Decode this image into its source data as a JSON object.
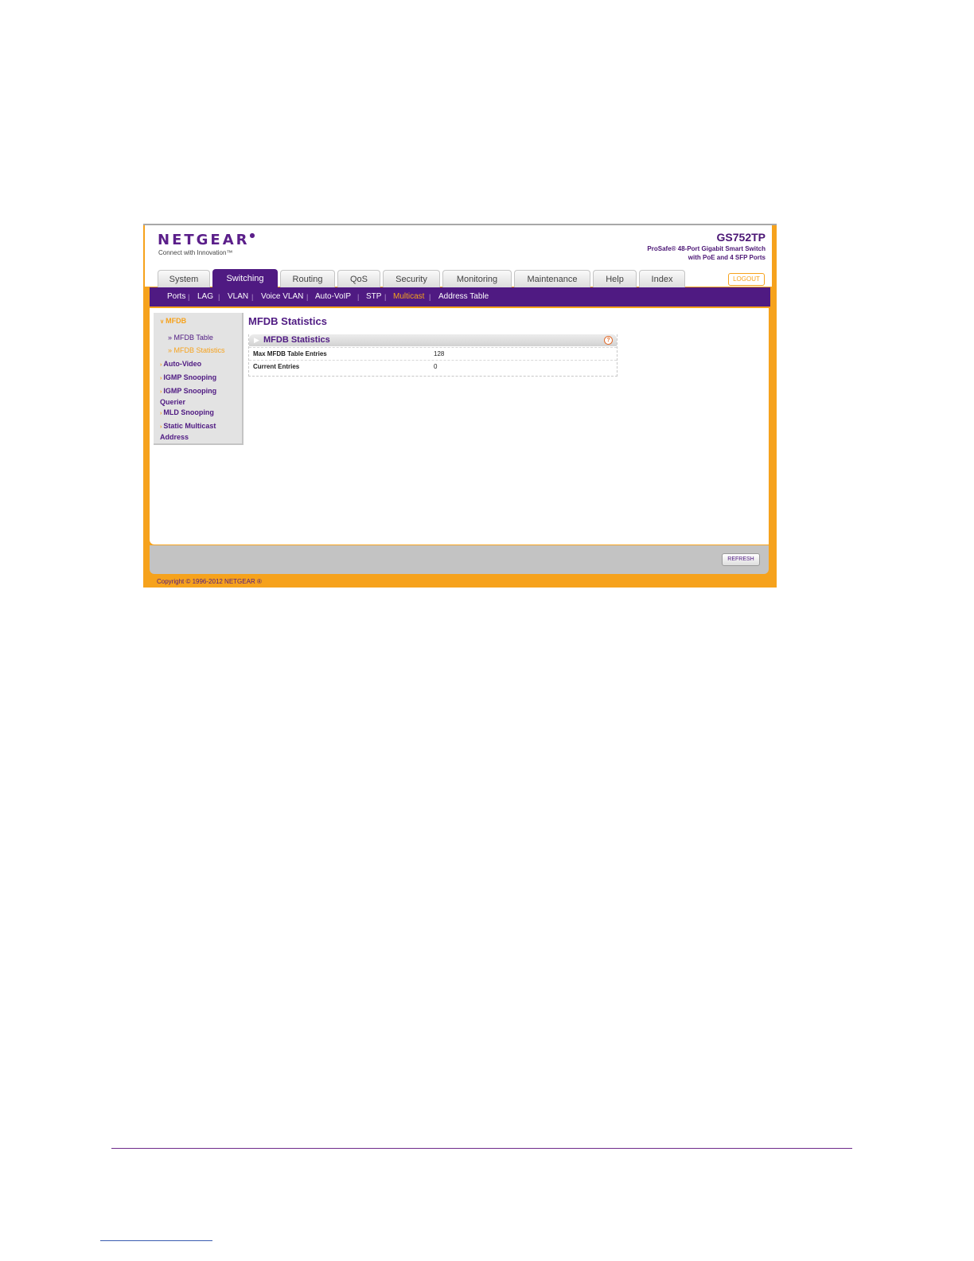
{
  "brand": {
    "logo": "NETGEAR",
    "tagline": "Connect with Innovation™",
    "model": "GS752TP",
    "product_line1": "ProSafe® 48-Port Gigabit Smart Switch",
    "product_line2": "with PoE and 4 SFP Ports"
  },
  "tabs": [
    "System",
    "Switching",
    "Routing",
    "QoS",
    "Security",
    "Monitoring",
    "Maintenance",
    "Help",
    "Index"
  ],
  "active_tab": "Switching",
  "logout_label": "LOGOUT",
  "subnav": [
    "Ports",
    "LAG",
    "VLAN",
    "Voice VLAN",
    "Auto-VoIP",
    "STP",
    "Multicast",
    "Address Table"
  ],
  "active_subnav": "Multicast",
  "sidebar": {
    "items": [
      {
        "label": "MFDB",
        "open": true,
        "children": [
          "MFDB Table",
          "MFDB Statistics"
        ]
      },
      {
        "label": "Auto-Video"
      },
      {
        "label": "IGMP Snooping"
      },
      {
        "label": "IGMP Snooping",
        "label2": "Querier"
      },
      {
        "label": "MLD Snooping"
      },
      {
        "label": "Static Multicast",
        "label2": "Address"
      }
    ],
    "active_child": "MFDB Statistics"
  },
  "page_title": "MFDB Statistics",
  "panel": {
    "title": "MFDB Statistics",
    "rows": [
      {
        "label": "Max MFDB Table Entries",
        "value": "128"
      },
      {
        "label": "Current Entries",
        "value": "0"
      }
    ]
  },
  "refresh_label": "REFRESH",
  "copyright": "Copyright © 1996-2012 NETGEAR ®",
  "colors": {
    "brand_purple": "#4f1a82",
    "accent_orange": "#f6a21c"
  },
  "icons": {
    "help": "help-icon",
    "bullet": "arrow-icon"
  }
}
